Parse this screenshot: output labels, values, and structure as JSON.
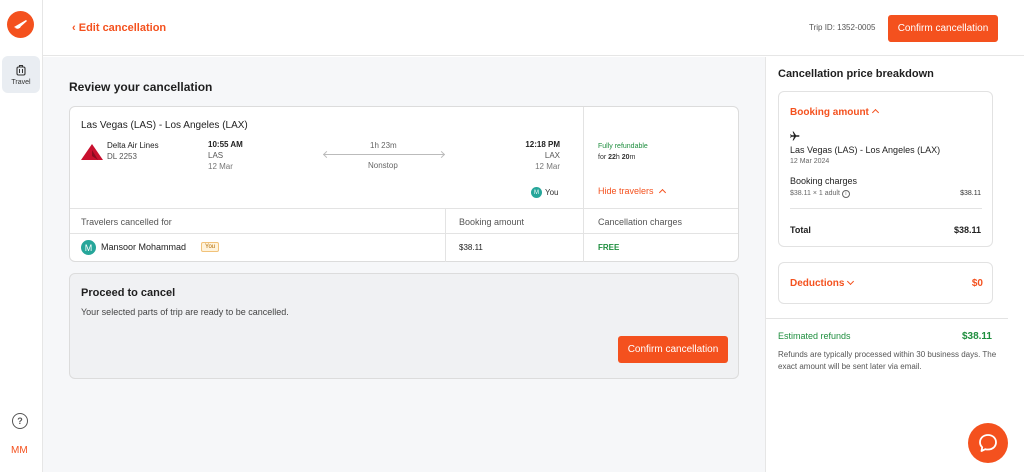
{
  "app": {
    "brand_color": "#f4511e",
    "success_color": "#1e8e3e"
  },
  "rail": {
    "travel_label": "Travel",
    "user_initials": "MM"
  },
  "header": {
    "back_label": "Edit cancellation",
    "trip_id_text": "Trip ID:  1352-0005",
    "confirm_label": "Confirm cancellation"
  },
  "main": {
    "title": "Review your cancellation",
    "flight": {
      "route": "Las Vegas (LAS) - Los Angeles (LAX)",
      "airline": "Delta Air Lines",
      "flight_number": "DL 2253",
      "departure": {
        "time": "10:55 AM",
        "code": "LAS",
        "date": "12 Mar"
      },
      "duration": "1h 23m",
      "stops": "Nonstop",
      "arrival": {
        "time": "12:18 PM",
        "code": "LAX",
        "date": "12 Mar"
      },
      "refund_status": "Fully refundable",
      "refund_prefix": "for ",
      "refund_hours": "22",
      "refund_h": "h ",
      "refund_minutes": "20",
      "refund_m": "m",
      "traveler_initial": "M",
      "you_label": "You",
      "hide_travelers_label": "Hide travelers"
    },
    "table": {
      "headers": [
        "Travelers cancelled for",
        "Booking amount",
        "Cancellation charges"
      ],
      "rows": [
        {
          "initial": "M",
          "name": "Mansoor Mohammad",
          "badge": "You",
          "amount": "$38.11",
          "charge": "FREE"
        }
      ]
    },
    "proceed": {
      "title": "Proceed to cancel",
      "description": "Your selected parts of trip are ready to be cancelled.",
      "confirm_label": "Confirm cancellation"
    }
  },
  "breakdown": {
    "title": "Cancellation price breakdown",
    "booking_amount_label": "Booking amount",
    "route": "Las Vegas (LAS) - Los Angeles (LAX)",
    "date": "12 Mar 2024",
    "booking_charges_label": "Booking charges",
    "calc": "$38.11 × 1 adult",
    "calc_value": "$38.11",
    "total_label": "Total",
    "total_value": "$38.11",
    "deductions_label": "Deductions",
    "deductions_value": "$0",
    "estimated_label": "Estimated refunds",
    "estimated_value": "$38.11",
    "note": "Refunds are typically processed within 30 business days. The exact amount will be sent later via email."
  }
}
